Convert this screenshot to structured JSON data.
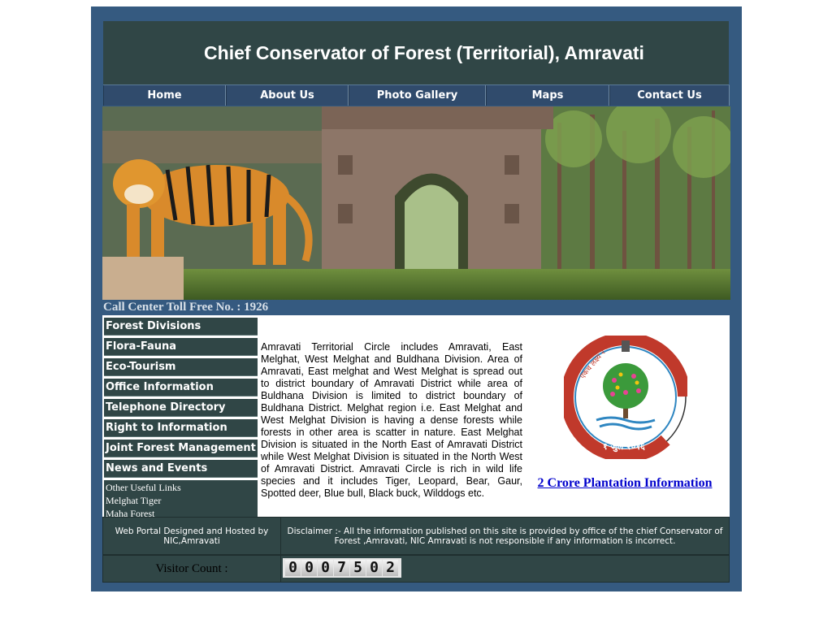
{
  "header": {
    "title": "Chief Conservator of Forest (Territorial), Amravati"
  },
  "nav": [
    {
      "label": "Home"
    },
    {
      "label": "About Us"
    },
    {
      "label": "Photo Gallery"
    },
    {
      "label": "Maps"
    },
    {
      "label": "Contact Us"
    }
  ],
  "call_center": "Call Center Toll Free No. : 1926",
  "sidebar": {
    "items": [
      {
        "label": "Forest Divisions"
      },
      {
        "label": "Flora-Fauna"
      },
      {
        "label": "Eco-Tourism"
      },
      {
        "label": "Office Information"
      },
      {
        "label": "Telephone Directory"
      },
      {
        "label": "Right to Information"
      },
      {
        "label": "Joint Forest Management"
      },
      {
        "label": "News and Events"
      }
    ],
    "other_links_heading": "Other Useful Links",
    "other_links": [
      {
        "label": "Melghat Tiger"
      },
      {
        "label": "Maha Forest"
      }
    ]
  },
  "main": {
    "description": "Amravati Territorial Circle includes Amravati, East Melghat, West Melghat and Buldhana Division. Area of Amravati, East melghat and West Melghat is spread out to district boundary of Amravati District while area of Buldhana Division is limited to district boundary of Buldhana District. Melghat region i.e. East Melghat and West Melghat Division  is having  a dense forests while forests in other area is scatter in nature. East Melghat Division is situated in the North East of Amravati District while West Melghat Division is situated in the North West of Amravati District. Amravati Circle is rich in wild life species and it includes Tiger, Leopard, Bear, Gaur, Spotted deer, Blue bull, Black buck, Wilddogs etc.",
    "logo": {
      "top_text": "एकच लक्ष्य २ कोटी वृक्ष",
      "bottom_text": "१ जुलै २०१६"
    },
    "plantation_link": "2 Crore Plantation Information"
  },
  "footer": {
    "designed_by": "Web Portal Designed and Hosted by NIC,Amravati",
    "disclaimer": "Disclaimer :- All the information published on this site is provided by office of the chief Conservator of Forest ,Amravati, NIC Amravati is not responsible if any information is incorrect.",
    "visitor_label": "Visitor Count :",
    "visitor_digits": [
      "0",
      "0",
      "0",
      "7",
      "5",
      "0",
      "2"
    ]
  },
  "colors": {
    "frame": "#355a80",
    "panel": "#304646",
    "nav": "#304b6c",
    "link": "#0000cc"
  }
}
